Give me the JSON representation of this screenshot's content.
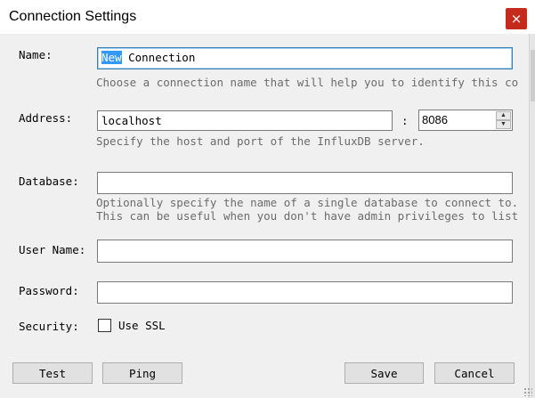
{
  "window": {
    "title": "Connection Settings",
    "close_icon": "×"
  },
  "name": {
    "label": "Name:",
    "value_selected": "New",
    "value_rest": " Connection",
    "hint": "Choose a connection name that will help you to identify this co"
  },
  "address": {
    "label": "Address:",
    "host": "localhost",
    "separator": ":",
    "port": "8086",
    "hint": "Specify the host and port of the InfluxDB server."
  },
  "database": {
    "label": "Database:",
    "value": "",
    "hint_line1": "Optionally specify the name of a single database to connect to.",
    "hint_line2": "This can be useful when you don't have admin privileges to list"
  },
  "username": {
    "label": "User Name:",
    "value": ""
  },
  "password": {
    "label": "Password:",
    "value": ""
  },
  "security": {
    "label": "Security:",
    "ssl_label": "Use SSL",
    "ssl_checked": false
  },
  "buttons": {
    "test": "Test",
    "ping": "Ping",
    "save": "Save",
    "cancel": "Cancel"
  },
  "colors": {
    "accent_selection": "#3399ff",
    "close_button": "#c42b1c",
    "focus_border": "#3c7fb1"
  }
}
